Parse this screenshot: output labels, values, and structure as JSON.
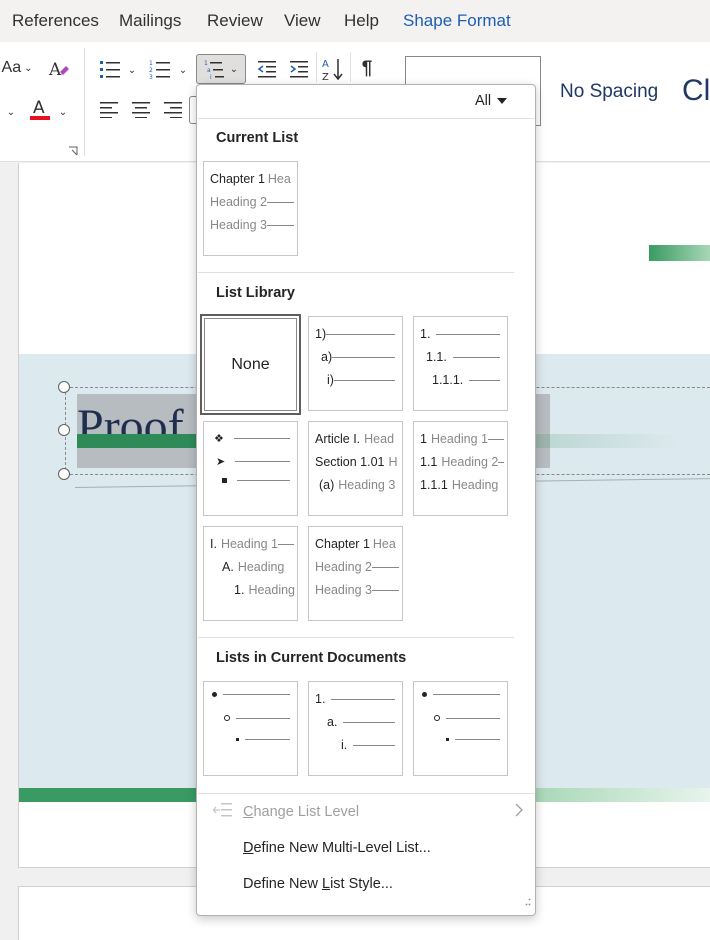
{
  "menubar": {
    "tabs": [
      {
        "label": "References"
      },
      {
        "label": "Mailings"
      },
      {
        "label": "Review"
      },
      {
        "label": "View"
      },
      {
        "label": "Help"
      },
      {
        "label": "Shape Format"
      }
    ]
  },
  "ribbon": {
    "change_case_label": "Aa",
    "styles": {
      "no_spacing": "No Spacing",
      "next_style_partial": "Cl"
    }
  },
  "document": {
    "title_partial": "Proof"
  },
  "dropdown": {
    "filter_label": "All",
    "current_list": {
      "title": "Current List",
      "tile": {
        "lines": [
          "Chapter 1",
          "Hea",
          "Heading 2",
          "Heading 3"
        ]
      }
    },
    "list_library": {
      "title": "List Library",
      "none_label": "None",
      "tile_numbered_1": [
        "1)",
        "a)",
        "i)"
      ],
      "tile_numbered_2": [
        "1.",
        "1.1.",
        "1.1.1."
      ],
      "tile_article": [
        "Article I.",
        "Head",
        "Section 1.01",
        "H",
        "(a)",
        "Heading 3"
      ],
      "tile_heading_numbers": [
        "1",
        "Heading 1",
        "1.1",
        "Heading 2",
        "1.1.1",
        "Heading"
      ],
      "tile_roman": [
        "I.",
        "Heading 1",
        "A.",
        "Heading",
        "1.",
        "Heading"
      ],
      "tile_chapter": [
        "Chapter 1",
        "Hea",
        "Heading 2",
        "Heading 3"
      ]
    },
    "lists_in_doc": {
      "title": "Lists in Current Documents",
      "tile_2": [
        "1.",
        "a.",
        "i."
      ]
    },
    "menu": {
      "change_level": {
        "pre": "",
        "acc": "C",
        "post": "hange List Level"
      },
      "define_list": {
        "pre": "",
        "acc": "D",
        "post": "efine New Multi-Level List..."
      },
      "define_style": {
        "pre": "Define New ",
        "acc": "L",
        "post": "ist Style..."
      }
    }
  },
  "colors": {
    "accent_blue": "#1e5eb0",
    "green": "#3a9a63",
    "doc_band": "#dce9ee",
    "title_dark": "#1f2d4f"
  }
}
